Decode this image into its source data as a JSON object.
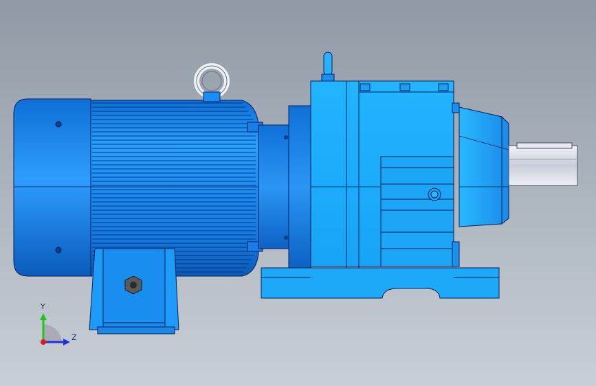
{
  "viewport": {
    "background_top": "#8f9aa6",
    "background_bottom": "#c9cfd6"
  },
  "model": {
    "part_color": "#1e90ff",
    "part_color_light": "#5ec8ff",
    "edge_color": "#0a1e5a",
    "shaft_color": "#d8dce6"
  },
  "triad": {
    "y_label": "Y",
    "z_label": "Z",
    "y_color": "#21c321",
    "z_color": "#2030e0",
    "origin_color": "#e01a1a"
  }
}
